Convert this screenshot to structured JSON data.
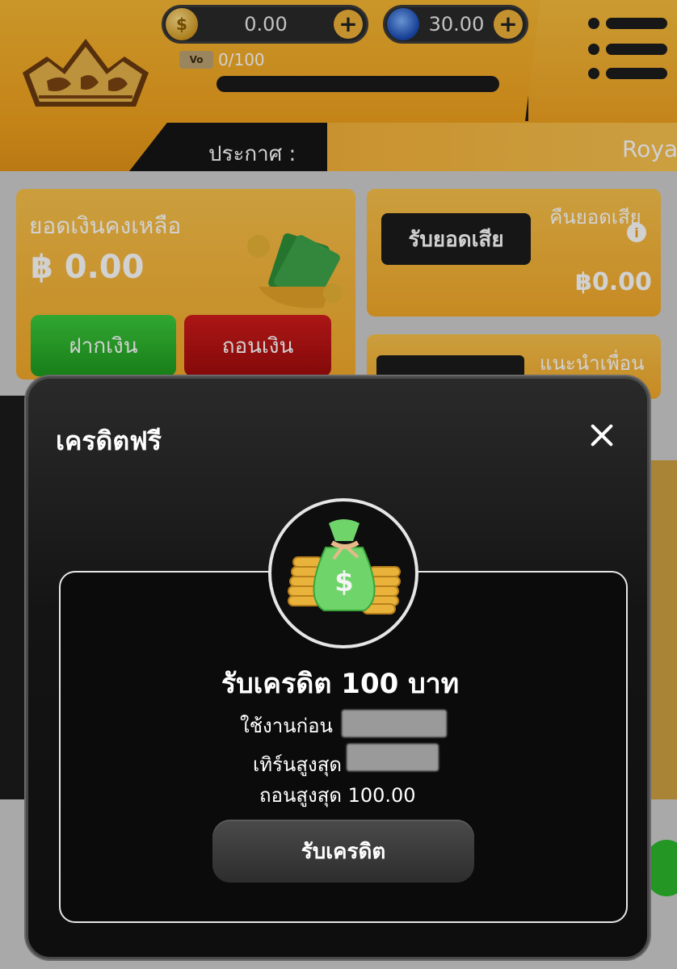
{
  "header": {
    "gold_amount": "0.00",
    "gem_amount": "30.00",
    "coin_symbol": "$",
    "vip_badge": "Vo",
    "vip_progress": "0/100",
    "vip_progress_fraction": 0,
    "announce_label": "ประกาศ :",
    "marquee_text": "Roya"
  },
  "dashboard": {
    "balance_label": "ยอดเงินคงเหลือ",
    "balance_value": "฿ 0.00",
    "deposit_label": "ฝากเงิน",
    "withdraw_label": "ถอนเงิน",
    "rebate_button": "รับยอดเสีย",
    "rebate_label": "คืนยอดเสีย",
    "rebate_value": "฿0.00",
    "refer_label": "แนะนำเพื่อน"
  },
  "modal": {
    "title": "เครดิตฟรี",
    "credit_title": "รับเครดิต 100 บาท",
    "use_before_label": "ใช้งานก่อน",
    "max_turnover_label": "เทิร์นสูงสุด",
    "max_withdraw_label": "ถอนสูงสุด 100.00",
    "claim_button": "รับเครดิต"
  },
  "colors": {
    "brand_gold": "#f0a21e",
    "deposit_green": "#2aa62a",
    "withdraw_red": "#b81414",
    "modal_bg": "#141414"
  },
  "icons": [
    "dollar-coin-icon",
    "plus-icon",
    "gem-icon",
    "crown-icon",
    "menu-icon",
    "money-stack-icon",
    "info-icon",
    "close-icon",
    "money-bag-icon"
  ]
}
